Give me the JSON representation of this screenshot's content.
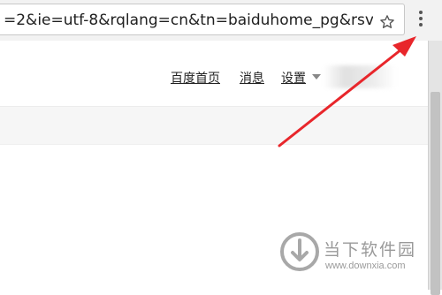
{
  "browser": {
    "url": "=2&ie=utf-8&rqlang=cn&tn=baiduhome_pg&rsv",
    "bookmark_icon": "star-icon",
    "menu_icon": "three-dot-vertical-menu-icon"
  },
  "nav": {
    "home": "百度首页",
    "messages": "消息",
    "settings": "设置"
  },
  "annotation": {
    "arrow_color": "#e8262b"
  },
  "watermark": {
    "name": "当下软件园",
    "url": "www.downxia.com"
  }
}
